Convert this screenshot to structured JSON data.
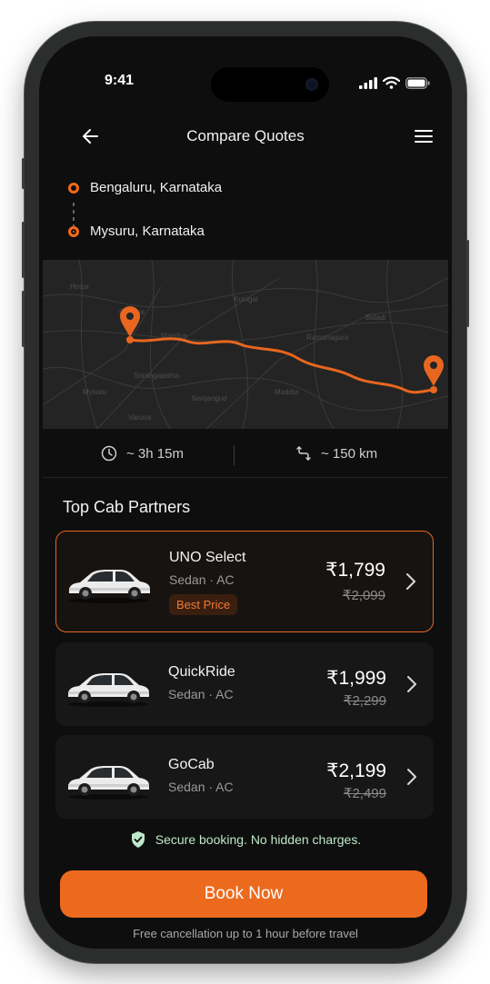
{
  "status": {
    "time": "9:41"
  },
  "header": {
    "title": "Compare Quotes"
  },
  "route": {
    "from": "Bengaluru, Karnataka",
    "to": "Mysuru, Karnataka"
  },
  "trip": {
    "duration": "~ 3h 15m",
    "distance": "~ 150 km"
  },
  "section_title": "Top Cab Partners",
  "partners": [
    {
      "name": "UNO Select",
      "type": "Sedan · AC",
      "price": "₹1,799",
      "old_price": "₹2,099",
      "badge": "Best Price"
    },
    {
      "name": "QuickRide",
      "type": "Sedan · AC",
      "price": "₹1,999",
      "old_price": "₹2,299"
    },
    {
      "name": "GoCab",
      "type": "Sedan · AC",
      "price": "₹2,199",
      "old_price": "₹2,499"
    }
  ],
  "secure_text": "Secure booking. No hidden charges.",
  "book_label": "Book Now",
  "cancel_note": "Free cancellation up to 1 hour before travel",
  "colors": {
    "accent": "#ec6a1d",
    "background": "#0e0e0e",
    "secure": "#bfe8c8"
  }
}
